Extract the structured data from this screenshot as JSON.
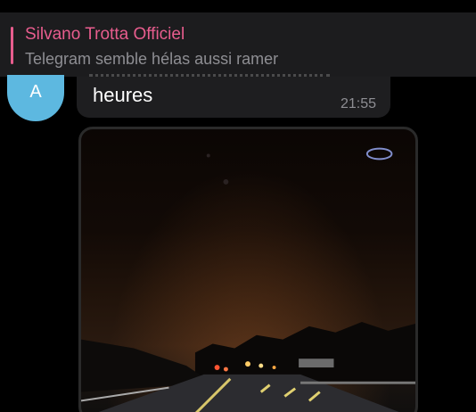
{
  "pinned": {
    "title": "Silvano Trotta Officiel",
    "text": "Telegram semble hélas aussi ramer"
  },
  "message": {
    "avatar_letter": "A",
    "text": "heures",
    "time": "21:55"
  },
  "colors": {
    "accent": "#e85d8e",
    "avatar": "#5db8e0",
    "bubble": "#1e1e20",
    "pinned_bg": "#1c1c1e"
  }
}
